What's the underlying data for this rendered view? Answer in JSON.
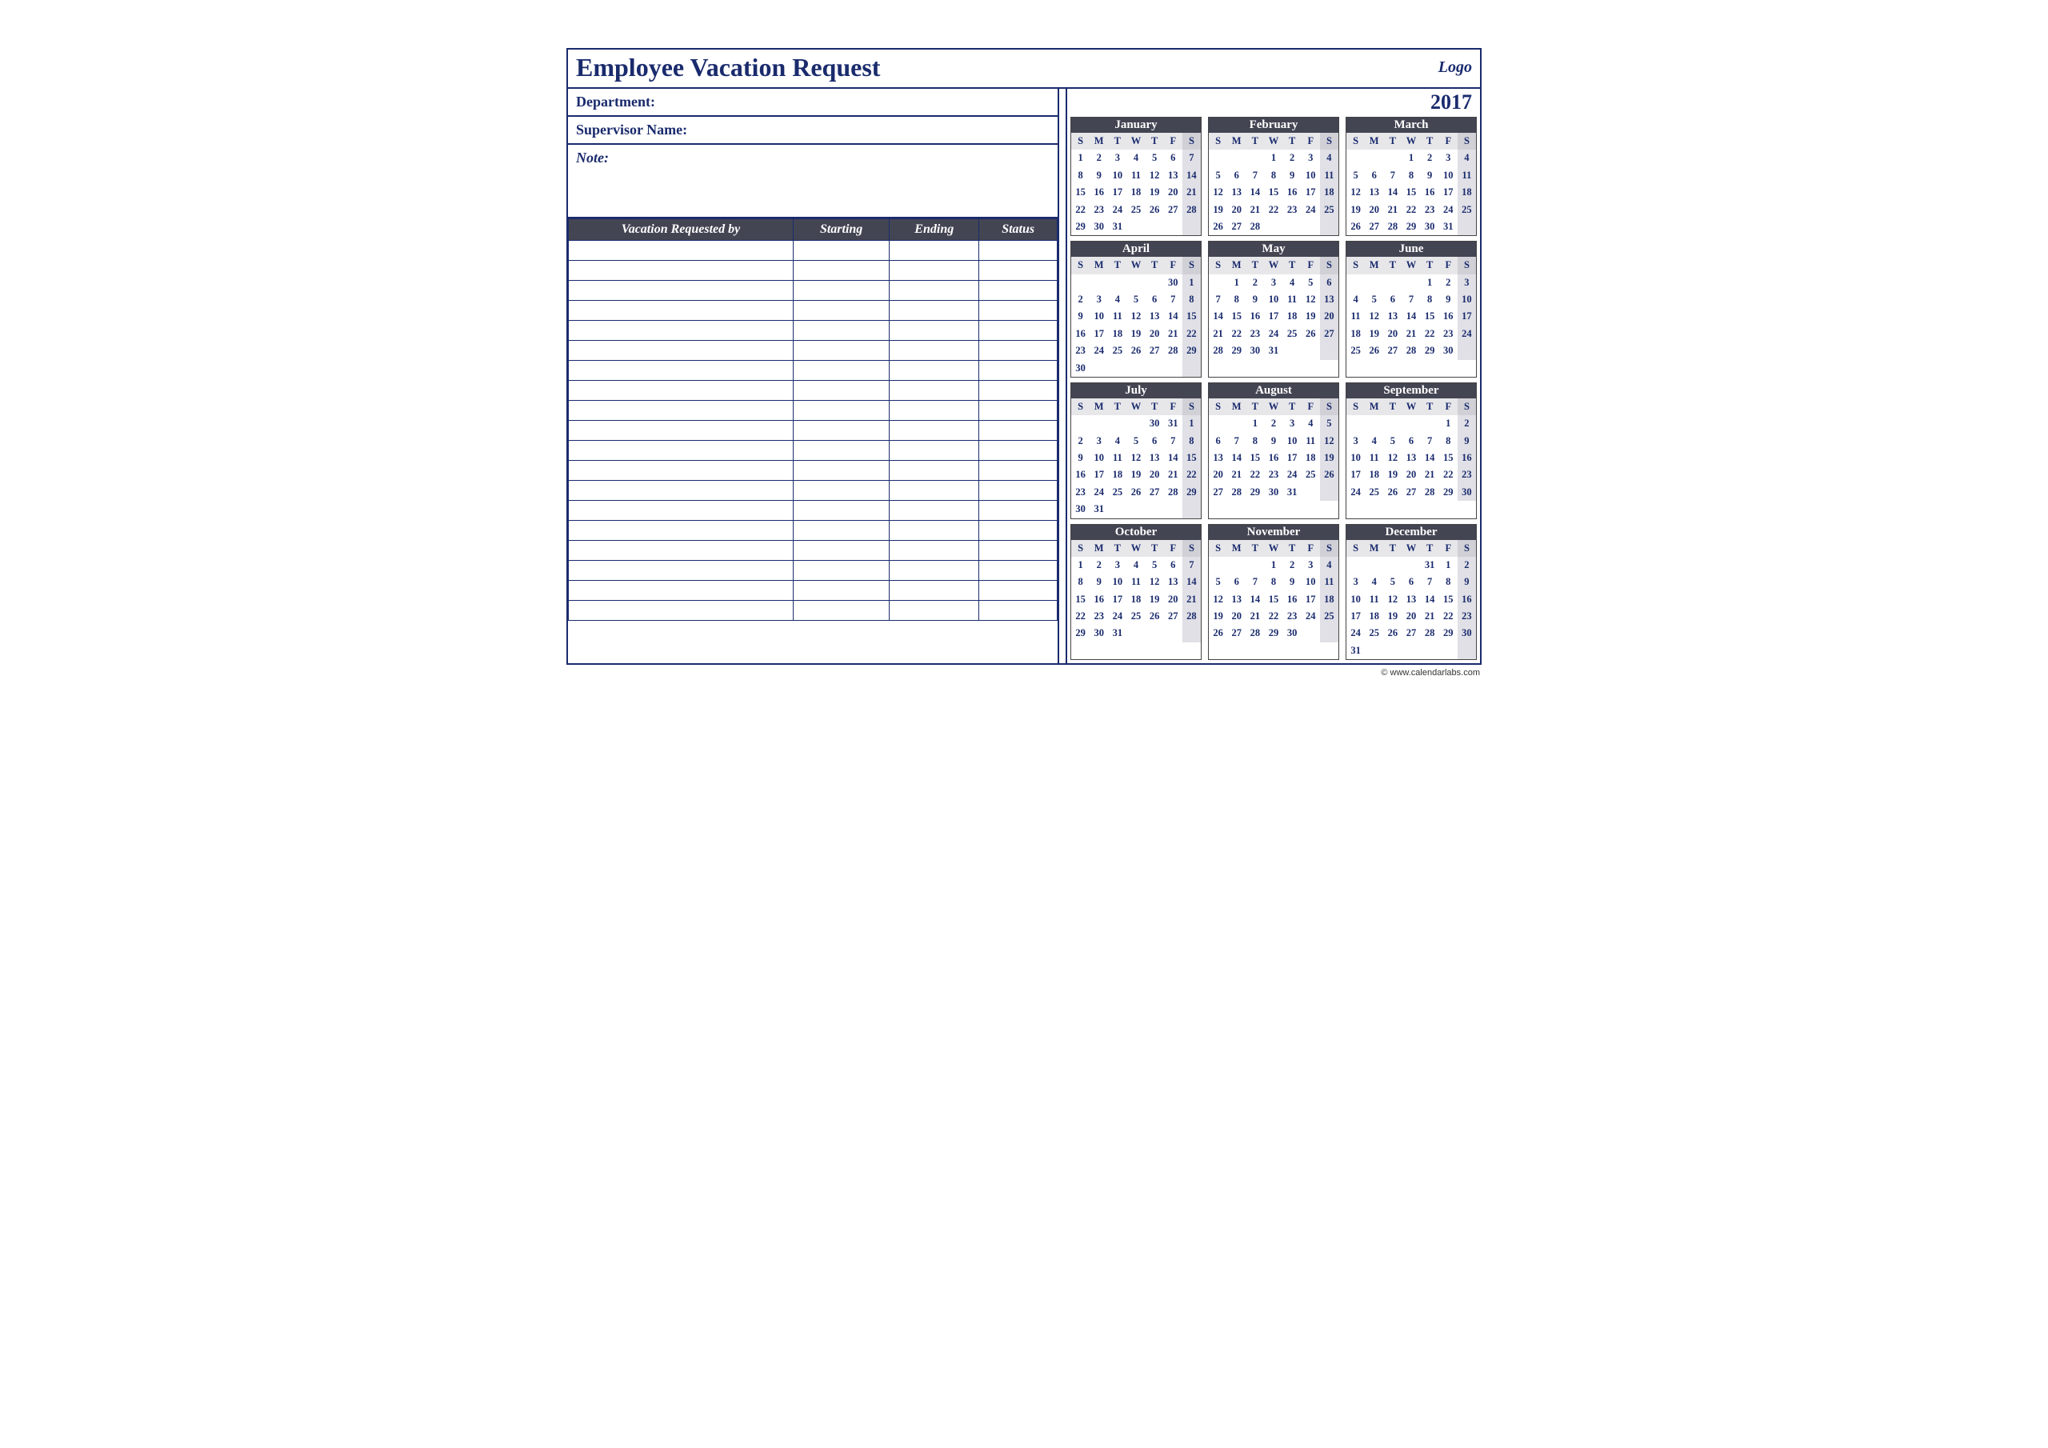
{
  "title": "Employee Vacation Request",
  "logo_text": "Logo",
  "fields": {
    "department_label": "Department:",
    "supervisor_label": "Supervisor Name:",
    "note_label": "Note:"
  },
  "table": {
    "headers": [
      "Vacation Requested by",
      "Starting",
      "Ending",
      "Status"
    ],
    "blank_rows": 19
  },
  "year": "2017",
  "day_headers": [
    "S",
    "M",
    "T",
    "W",
    "T",
    "F",
    "S"
  ],
  "months": [
    {
      "name": "January",
      "start": 0,
      "days": 31,
      "prev_tail": []
    },
    {
      "name": "February",
      "start": 3,
      "days": 28,
      "prev_tail": []
    },
    {
      "name": "March",
      "start": 3,
      "days": 31,
      "prev_tail": []
    },
    {
      "name": "April",
      "start": 6,
      "days": 30,
      "prev_tail": [
        30
      ]
    },
    {
      "name": "May",
      "start": 1,
      "days": 31,
      "prev_tail": []
    },
    {
      "name": "June",
      "start": 4,
      "days": 30,
      "prev_tail": []
    },
    {
      "name": "July",
      "start": 6,
      "days": 31,
      "prev_tail": [
        30,
        31
      ]
    },
    {
      "name": "August",
      "start": 2,
      "days": 31,
      "prev_tail": []
    },
    {
      "name": "September",
      "start": 5,
      "days": 30,
      "prev_tail": []
    },
    {
      "name": "October",
      "start": 0,
      "days": 31,
      "prev_tail": []
    },
    {
      "name": "November",
      "start": 3,
      "days": 30,
      "prev_tail": []
    },
    {
      "name": "December",
      "start": 5,
      "days": 31,
      "prev_tail": [
        31
      ]
    }
  ],
  "footer": "© www.calendarlabs.com"
}
